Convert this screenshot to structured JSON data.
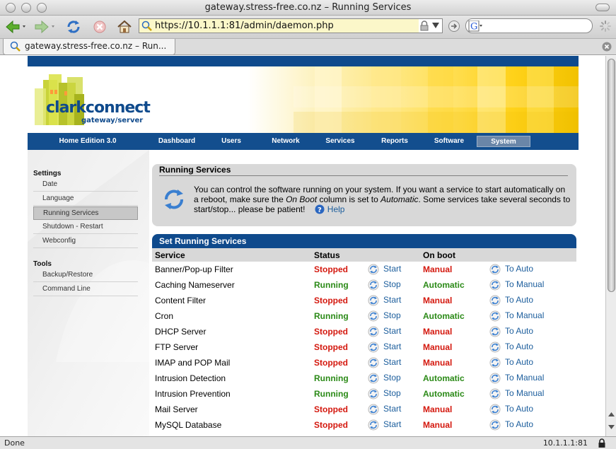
{
  "window": {
    "title": "gateway.stress-free.co.nz – Running Services"
  },
  "toolbar": {
    "url": "https://10.1.1.1:81/admin/daemon.php",
    "icons": [
      "back-arrow-icon",
      "forward-arrow-icon",
      "reload-icon",
      "stop-icon",
      "home-icon",
      "lock-icon",
      "dropdown-icon",
      "go-icon",
      "google-icon",
      "spinner-icon"
    ]
  },
  "tab": {
    "label": "gateway.stress-free.co.nz – Run..."
  },
  "banner": {
    "brand": "clarkconnect",
    "tagline": "gateway/server"
  },
  "nav": {
    "edition": "Home Edition 3.0",
    "items": [
      "Dashboard",
      "Users",
      "Network",
      "Services",
      "Reports",
      "Software",
      "System"
    ],
    "active": "System"
  },
  "sidebar": {
    "settings_heading": "Settings",
    "settings": [
      "Date",
      "Language",
      "Running Services",
      "Shutdown - Restart",
      "Webconfig"
    ],
    "tools_heading": "Tools",
    "tools": [
      "Backup/Restore",
      "Command Line"
    ],
    "active": "Running Services"
  },
  "info": {
    "title": "Running Services",
    "text1": "You can control the software running on your system.  If you want a service to start automatically on a reboot, make sure the ",
    "em1": "On Boot",
    "text2": " column is set to ",
    "em2": "Automatic",
    "text3": ".  Some services take several seconds to start/stop... please be patient!",
    "help": "Help"
  },
  "services": {
    "title": "Set Running Services",
    "headers": {
      "service": "Service",
      "status": "Status",
      "onboot": "On boot"
    },
    "rows": [
      {
        "name": "Banner/Pop-up Filter",
        "status": "Stopped",
        "action": "Start",
        "boot": "Manual",
        "boot_action": "To Auto"
      },
      {
        "name": "Caching Nameserver",
        "status": "Running",
        "action": "Stop",
        "boot": "Automatic",
        "boot_action": "To Manual"
      },
      {
        "name": "Content Filter",
        "status": "Stopped",
        "action": "Start",
        "boot": "Manual",
        "boot_action": "To Auto"
      },
      {
        "name": "Cron",
        "status": "Running",
        "action": "Stop",
        "boot": "Automatic",
        "boot_action": "To Manual"
      },
      {
        "name": "DHCP Server",
        "status": "Stopped",
        "action": "Start",
        "boot": "Manual",
        "boot_action": "To Auto"
      },
      {
        "name": "FTP Server",
        "status": "Stopped",
        "action": "Start",
        "boot": "Manual",
        "boot_action": "To Auto"
      },
      {
        "name": "IMAP and POP Mail",
        "status": "Stopped",
        "action": "Start",
        "boot": "Manual",
        "boot_action": "To Auto"
      },
      {
        "name": "Intrusion Detection",
        "status": "Running",
        "action": "Stop",
        "boot": "Automatic",
        "boot_action": "To Manual"
      },
      {
        "name": "Intrusion Prevention",
        "status": "Running",
        "action": "Stop",
        "boot": "Automatic",
        "boot_action": "To Manual"
      },
      {
        "name": "Mail Server",
        "status": "Stopped",
        "action": "Start",
        "boot": "Manual",
        "boot_action": "To Auto"
      },
      {
        "name": "MySQL Database",
        "status": "Stopped",
        "action": "Start",
        "boot": "Manual",
        "boot_action": "To Auto"
      }
    ]
  },
  "status": {
    "left": "Done",
    "right": "10.1.1.1:81"
  },
  "colors": {
    "brand_blue": "#0f4a8c",
    "running": "#2b8a17",
    "stopped": "#d4180e",
    "banner_yellow": "#ffd21a"
  }
}
